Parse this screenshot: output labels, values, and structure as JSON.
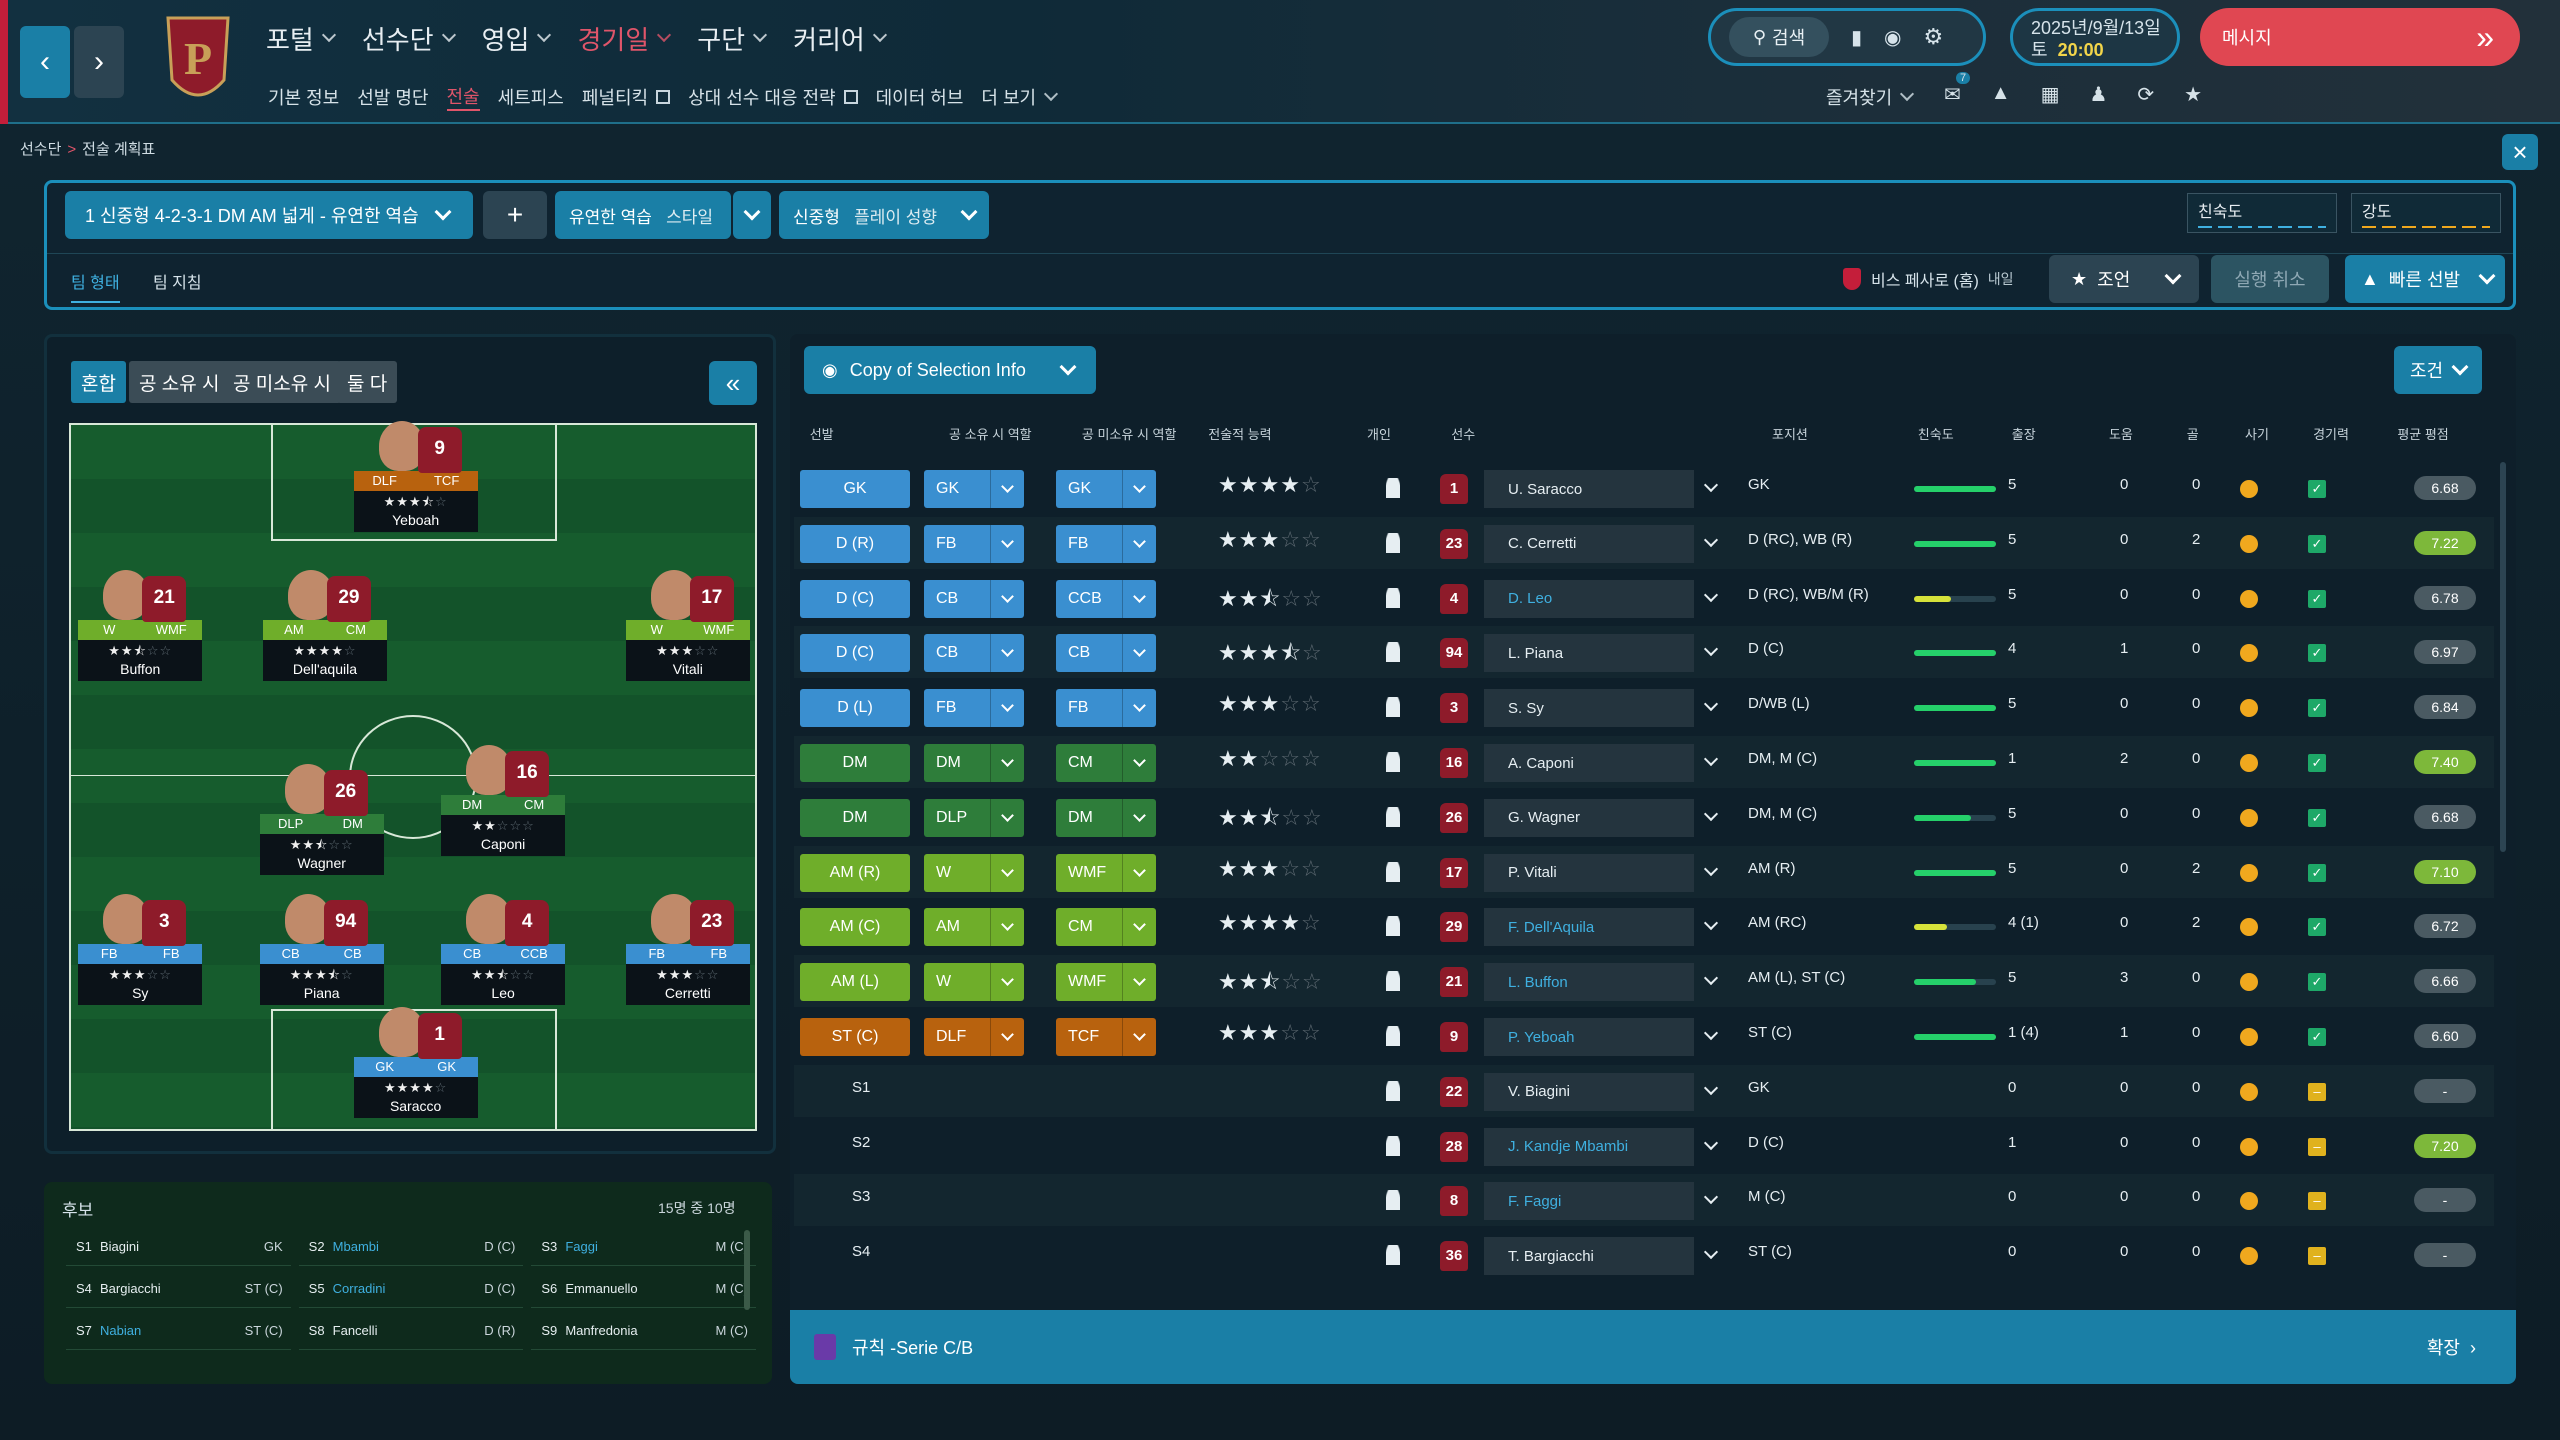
{
  "topbar": {
    "main_nav": [
      "포털",
      "선수단",
      "영입",
      "경기일",
      "구단",
      "커리어"
    ],
    "active_main": 3,
    "sub_nav": [
      "기본 정보",
      "선발 명단",
      "전술",
      "세트피스",
      "페널티킥",
      "상대 선수 대응 전략",
      "데이터 허브",
      "더 보기"
    ],
    "active_sub": 2,
    "search_label": "검색",
    "date": "2025년/9월/13일",
    "day": "토",
    "time": "20:00",
    "message_label": "메시지",
    "favorites_label": "즐겨찾기",
    "notification_count": "7"
  },
  "breadcrumb": {
    "parent": "선수단",
    "current": "전술 계획표"
  },
  "tactic": {
    "selector": "1  신중형 4-2-3-1 DM AM 넓게 - 유연한 역습",
    "add_label": "+",
    "style_prefix": "유연한 역습",
    "style_label": "스타일",
    "mentality_prefix": "신중형",
    "mentality_label": "플레이 성향",
    "familiarity_label": "친숙도",
    "intensity_label": "강도",
    "tabs": [
      "팀 형태",
      "팀 지침"
    ],
    "next_opponent": "비스 페사로 (홈)",
    "next_when": "내일",
    "advice_label": "조언",
    "undo_label": "실행 취소",
    "quick_pick_label": "빠른 선발"
  },
  "pitch": {
    "segments": [
      "혼합",
      "공 소유 시",
      "공 미소유 시",
      "둘 다"
    ],
    "players": [
      {
        "name": "Yeboah",
        "num": "9",
        "r1": "DLF",
        "r2": "TCF",
        "stars": 3.5,
        "c1": "#b8620e",
        "c2": "#b8620e"
      },
      {
        "name": "Buffon",
        "num": "21",
        "r1": "W",
        "r2": "WMF",
        "stars": 2.5,
        "c1": "#6fae2a",
        "c2": "#6fae2a"
      },
      {
        "name": "Dell'aquila",
        "num": "29",
        "r1": "AM",
        "r2": "CM",
        "stars": 4,
        "c1": "#6fae2a",
        "c2": "#6fae2a"
      },
      {
        "name": "Vitali",
        "num": "17",
        "r1": "W",
        "r2": "WMF",
        "stars": 3,
        "c1": "#6fae2a",
        "c2": "#6fae2a"
      },
      {
        "name": "Wagner",
        "num": "26",
        "r1": "DLP",
        "r2": "DM",
        "stars": 2.5,
        "c1": "#2e7d3a",
        "c2": "#2e7d3a"
      },
      {
        "name": "Caponi",
        "num": "16",
        "r1": "DM",
        "r2": "CM",
        "stars": 2,
        "c1": "#2e7d3a",
        "c2": "#2e7d3a"
      },
      {
        "name": "Sy",
        "num": "3",
        "r1": "FB",
        "r2": "FB",
        "stars": 3,
        "c1": "#3a8fd0",
        "c2": "#3a8fd0"
      },
      {
        "name": "Piana",
        "num": "94",
        "r1": "CB",
        "r2": "CB",
        "stars": 3.5,
        "c1": "#3a8fd0",
        "c2": "#3a8fd0"
      },
      {
        "name": "Leo",
        "num": "4",
        "r1": "CB",
        "r2": "CCB",
        "stars": 2.5,
        "c1": "#3a8fd0",
        "c2": "#3a8fd0"
      },
      {
        "name": "Cerretti",
        "num": "23",
        "r1": "FB",
        "r2": "FB",
        "stars": 3,
        "c1": "#3a8fd0",
        "c2": "#3a8fd0"
      },
      {
        "name": "Saracco",
        "num": "1",
        "r1": "GK",
        "r2": "GK",
        "stars": 4,
        "c1": "#3a8fd0",
        "c2": "#3a8fd0"
      }
    ]
  },
  "subs": {
    "title": "후보",
    "count": "15명 중 10명",
    "items": [
      {
        "slot": "S1",
        "name": "Biagini",
        "pos": "GK",
        "link": false
      },
      {
        "slot": "S2",
        "name": "Mbambi",
        "pos": "D (C)",
        "link": true
      },
      {
        "slot": "S3",
        "name": "Faggi",
        "pos": "M (C)",
        "link": true
      },
      {
        "slot": "S4",
        "name": "Bargiacchi",
        "pos": "ST (C)",
        "link": false
      },
      {
        "slot": "S5",
        "name": "Corradini",
        "pos": "D (C)",
        "link": true
      },
      {
        "slot": "S6",
        "name": "Emmanuello",
        "pos": "M (C)",
        "link": false
      },
      {
        "slot": "S7",
        "name": "Nabian",
        "pos": "ST (C)",
        "link": true
      },
      {
        "slot": "S8",
        "name": "Fancelli",
        "pos": "D (R)",
        "link": false
      },
      {
        "slot": "S9",
        "name": "Manfredonia",
        "pos": "M (C)",
        "link": false
      }
    ]
  },
  "table": {
    "copy_label": "Copy of Selection Info",
    "cond_label": "조건",
    "headers": [
      "선발",
      "공 소유 시 역할",
      "공 미소유 시 역할",
      "전술적 능력",
      "개인",
      "선수",
      "포지션",
      "친숙도",
      "출장",
      "도움",
      "골",
      "사기",
      "경기력",
      "평균 평점"
    ],
    "rows": [
      {
        "sel": "GK",
        "r1": "GK",
        "r2": "GK",
        "stars": 4,
        "num": "1",
        "name": "U. Saracco",
        "link": false,
        "pos": "GK",
        "fam": 100,
        "apps": "5",
        "ast": "0",
        "gls": "0",
        "avg": "6.68",
        "hi": false
      },
      {
        "sel": "D (R)",
        "r1": "FB",
        "r2": "FB",
        "stars": 3,
        "num": "23",
        "name": "C. Cerretti",
        "link": false,
        "pos": "D (RC), WB (R)",
        "fam": 100,
        "apps": "5",
        "ast": "0",
        "gls": "2",
        "avg": "7.22",
        "hi": true
      },
      {
        "sel": "D (C)",
        "r1": "CB",
        "r2": "CCB",
        "stars": 2.5,
        "num": "4",
        "name": "D. Leo",
        "link": true,
        "pos": "D (RC), WB/M (R)",
        "fam": 45,
        "apps": "5",
        "ast": "0",
        "gls": "0",
        "avg": "6.78",
        "hi": false
      },
      {
        "sel": "D (C)",
        "r1": "CB",
        "r2": "CB",
        "stars": 3.5,
        "num": "94",
        "name": "L. Piana",
        "link": false,
        "pos": "D (C)",
        "fam": 100,
        "apps": "4",
        "ast": "1",
        "gls": "0",
        "avg": "6.97",
        "hi": false
      },
      {
        "sel": "D (L)",
        "r1": "FB",
        "r2": "FB",
        "stars": 3,
        "num": "3",
        "name": "S. Sy",
        "link": false,
        "pos": "D/WB (L)",
        "fam": 100,
        "apps": "5",
        "ast": "0",
        "gls": "0",
        "avg": "6.84",
        "hi": false
      },
      {
        "sel": "DM",
        "r1": "DM",
        "r2": "CM",
        "stars": 2,
        "num": "16",
        "name": "A. Caponi",
        "link": false,
        "pos": "DM, M (C)",
        "fam": 100,
        "apps": "1",
        "ast": "2",
        "gls": "0",
        "avg": "7.40",
        "hi": true
      },
      {
        "sel": "DM",
        "r1": "DLP",
        "r2": "DM",
        "stars": 2.5,
        "num": "26",
        "name": "G. Wagner",
        "link": false,
        "pos": "DM, M (C)",
        "fam": 70,
        "apps": "5",
        "ast": "0",
        "gls": "0",
        "avg": "6.68",
        "hi": false
      },
      {
        "sel": "AM (R)",
        "r1": "W",
        "r2": "WMF",
        "stars": 3,
        "num": "17",
        "name": "P. Vitali",
        "link": false,
        "pos": "AM (R)",
        "fam": 100,
        "apps": "5",
        "ast": "0",
        "gls": "2",
        "avg": "7.10",
        "hi": true
      },
      {
        "sel": "AM (C)",
        "r1": "AM",
        "r2": "CM",
        "stars": 4,
        "num": "29",
        "name": "F. Dell'Aquila",
        "link": true,
        "pos": "AM (RC)",
        "fam": 40,
        "apps": "4 (1)",
        "ast": "0",
        "gls": "2",
        "avg": "6.72",
        "hi": false
      },
      {
        "sel": "AM (L)",
        "r1": "W",
        "r2": "WMF",
        "stars": 2.5,
        "num": "21",
        "name": "L. Buffon",
        "link": true,
        "pos": "AM (L), ST (C)",
        "fam": 75,
        "apps": "5",
        "ast": "3",
        "gls": "0",
        "avg": "6.66",
        "hi": false
      },
      {
        "sel": "ST (C)",
        "r1": "DLF",
        "r2": "TCF",
        "stars": 3,
        "num": "9",
        "name": "P. Yeboah",
        "link": true,
        "pos": "ST (C)",
        "fam": 100,
        "apps": "1 (4)",
        "ast": "1",
        "gls": "0",
        "avg": "6.60",
        "hi": false
      },
      {
        "sel": "S1",
        "r1": "",
        "r2": "",
        "stars": 0,
        "num": "22",
        "name": "V. Biagini",
        "link": false,
        "pos": "GK",
        "fam": 0,
        "apps": "0",
        "ast": "0",
        "gls": "0",
        "avg": "-",
        "hi": false
      },
      {
        "sel": "S2",
        "r1": "",
        "r2": "",
        "stars": 0,
        "num": "28",
        "name": "J. Kandje Mbambi",
        "link": true,
        "pos": "D (C)",
        "fam": 0,
        "apps": "1",
        "ast": "0",
        "gls": "0",
        "avg": "7.20",
        "hi": true
      },
      {
        "sel": "S3",
        "r1": "",
        "r2": "",
        "stars": 0,
        "num": "8",
        "name": "F. Faggi",
        "link": true,
        "pos": "M (C)",
        "fam": 0,
        "apps": "0",
        "ast": "0",
        "gls": "0",
        "avg": "-",
        "hi": false
      },
      {
        "sel": "S4",
        "r1": "",
        "r2": "",
        "stars": 0,
        "num": "36",
        "name": "T. Bargiacchi",
        "link": false,
        "pos": "ST (C)",
        "fam": 0,
        "apps": "0",
        "ast": "0",
        "gls": "0",
        "avg": "-",
        "hi": false
      }
    ],
    "footer_label": "규칙 -Serie C/B",
    "footer_expand": "확장"
  },
  "colors": {
    "accent": "#1a7fa6",
    "active": "#e0556a",
    "def": "#3a8fd0",
    "dm": "#2e7d3a",
    "att": "#6fae2a",
    "st": "#b8620e"
  }
}
